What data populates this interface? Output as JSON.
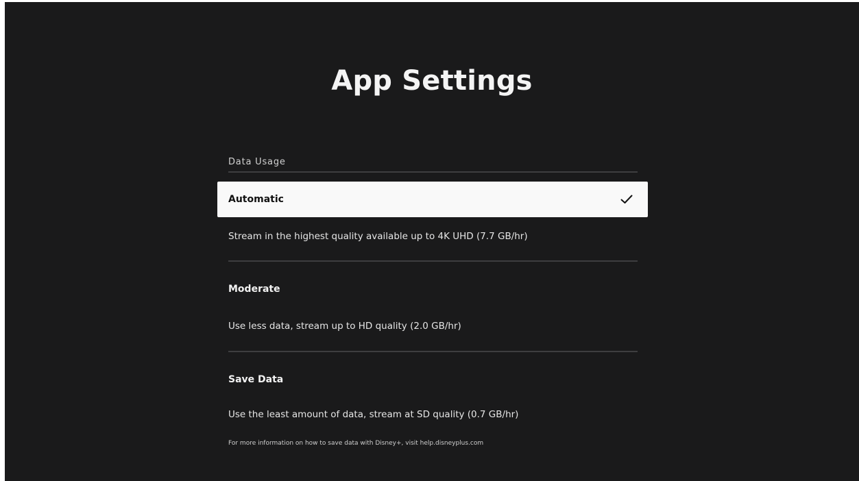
{
  "header": {
    "title": "App Settings"
  },
  "data_usage": {
    "section_label": "Data Usage",
    "selected_option": "Automatic",
    "options": [
      {
        "label": "Automatic",
        "description": "Stream in the highest quality available up to 4K UHD (7.7 GB/hr)",
        "selected": true,
        "icon": "checkmark-icon"
      },
      {
        "label": "Moderate",
        "description": "Use less data, stream up to HD quality (2.0 GB/hr)",
        "selected": false
      },
      {
        "label": "Save Data",
        "description": "Use the least amount of data, stream at SD quality (0.7 GB/hr)",
        "selected": false
      }
    ],
    "footnote": "For more information on how to save data with Disney+, visit help.disneyplus.com"
  },
  "colors": {
    "background": "#1a1a1b",
    "text": "#f2f2f2",
    "selected_row_background": "#f9f9f9",
    "selected_row_text": "#111111",
    "divider": "#3e3e40"
  }
}
